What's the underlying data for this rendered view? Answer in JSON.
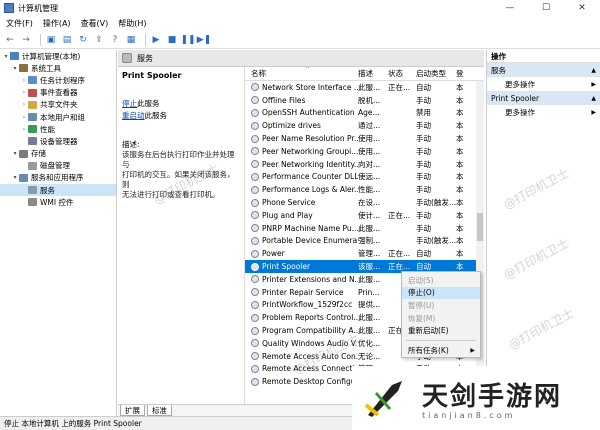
{
  "window": {
    "title": "计算机管理",
    "controls": [
      "—",
      "☐",
      "✕"
    ]
  },
  "menu": [
    "文件(F)",
    "操作(A)",
    "查看(V)",
    "帮助(H)"
  ],
  "tree": [
    {
      "label": "计算机管理(本地)",
      "level": 0,
      "arrow": "▾",
      "color": "#4a7fc1"
    },
    {
      "label": "系统工具",
      "level": 1,
      "arrow": "▾",
      "color": "#8a6d3b"
    },
    {
      "label": "任务计划程序",
      "level": 2,
      "arrow": "›",
      "color": "#5b8bd0"
    },
    {
      "label": "事件查看器",
      "level": 2,
      "arrow": "›",
      "color": "#c05050"
    },
    {
      "label": "共享文件夹",
      "level": 2,
      "arrow": "›",
      "color": "#d4a740"
    },
    {
      "label": "本地用户和组",
      "level": 2,
      "arrow": "›",
      "color": "#6a8ab0"
    },
    {
      "label": "性能",
      "level": 2,
      "arrow": "›",
      "color": "#3a9a5a"
    },
    {
      "label": "设备管理器",
      "level": 2,
      "arrow": "",
      "color": "#7a7a9a"
    },
    {
      "label": "存储",
      "level": 1,
      "arrow": "▾",
      "color": "#7a7a7a"
    },
    {
      "label": "磁盘管理",
      "level": 2,
      "arrow": "",
      "color": "#9a9a9a"
    },
    {
      "label": "服务和应用程序",
      "level": 1,
      "arrow": "▾",
      "color": "#6a8ab0"
    },
    {
      "label": "服务",
      "level": 2,
      "arrow": "",
      "color": "#8a9aaa",
      "selected": true
    },
    {
      "label": "WMI 控件",
      "level": 2,
      "arrow": "",
      "color": "#8a8a8a"
    }
  ],
  "header": {
    "title": "服务"
  },
  "detail": {
    "service_name": "Print Spooler",
    "stop_link": "停止",
    "stop_suffix": "此服务",
    "restart_link": "重启动",
    "restart_suffix": "此服务",
    "desc_label": "描述:",
    "desc_text": [
      "该服务在后台执行打印作业并处理与",
      "打印机的交互。如果关闭该服务，则",
      "无法进行打印或查看打印机。"
    ]
  },
  "columns": {
    "name": "名称",
    "desc": "描述",
    "state": "状态",
    "start": "启动类型",
    "login": "登"
  },
  "services": [
    {
      "name": "Network Store Interface ...",
      "desc": "此服...",
      "state": "正在...",
      "start": "自动",
      "login": "本"
    },
    {
      "name": "Offline Files",
      "desc": "脱机...",
      "state": "",
      "start": "手动",
      "login": "本"
    },
    {
      "name": "OpenSSH Authentication ...",
      "desc": "Age...",
      "state": "",
      "start": "禁用",
      "login": "本"
    },
    {
      "name": "Optimize drives",
      "desc": "通过...",
      "state": "",
      "start": "手动",
      "login": "本"
    },
    {
      "name": "Peer Name Resolution Pr...",
      "desc": "使用...",
      "state": "",
      "start": "手动",
      "login": "本"
    },
    {
      "name": "Peer Networking Groupi...",
      "desc": "使用...",
      "state": "",
      "start": "手动",
      "login": "本"
    },
    {
      "name": "Peer Networking Identity...",
      "desc": "向对...",
      "state": "",
      "start": "手动",
      "login": "本"
    },
    {
      "name": "Performance Counter DLL...",
      "desc": "使远...",
      "state": "",
      "start": "手动",
      "login": "本"
    },
    {
      "name": "Performance Logs & Aler...",
      "desc": "性能...",
      "state": "",
      "start": "手动",
      "login": "本"
    },
    {
      "name": "Phone Service",
      "desc": "在设...",
      "state": "",
      "start": "手动(触发...",
      "login": "本"
    },
    {
      "name": "Plug and Play",
      "desc": "使计...",
      "state": "正在...",
      "start": "手动",
      "login": "本"
    },
    {
      "name": "PNRP Machine Name Pu...",
      "desc": "此服...",
      "state": "",
      "start": "手动",
      "login": "本"
    },
    {
      "name": "Portable Device Enumera...",
      "desc": "强制...",
      "state": "",
      "start": "手动(触发...",
      "login": "本"
    },
    {
      "name": "Power",
      "desc": "管理...",
      "state": "正在...",
      "start": "自动",
      "login": "本"
    },
    {
      "name": "Print Spooler",
      "desc": "该服...",
      "state": "正在...",
      "start": "自动",
      "login": "本",
      "selected": true
    },
    {
      "name": "Printer Extensions and N...",
      "desc": "此服...",
      "state": "",
      "start": "手动",
      "login": "本"
    },
    {
      "name": "Printer Repair Service",
      "desc": "Prin...",
      "state": "",
      "start": "手动",
      "login": "本"
    },
    {
      "name": "PrintWorkflow_1529f2cc",
      "desc": "提供...",
      "state": "",
      "start": "手动",
      "login": "本"
    },
    {
      "name": "Problem Reports Control...",
      "desc": "此服...",
      "state": "",
      "start": "手动",
      "login": "本"
    },
    {
      "name": "Program Compatibility A...",
      "desc": "此服...",
      "state": "正在...",
      "start": "自动",
      "login": "本"
    },
    {
      "name": "Quality Windows Audio V...",
      "desc": "优化...",
      "state": "",
      "start": "手动",
      "login": "本"
    },
    {
      "name": "Remote Access Auto Con...",
      "desc": "无论...",
      "state": "",
      "start": "手动",
      "login": "本"
    },
    {
      "name": "Remote Access Connecti...",
      "desc": "管理...",
      "state": "",
      "start": "手动",
      "login": "本"
    },
    {
      "name": "Remote Desktop Configu...",
      "desc": "远程...",
      "state": "",
      "start": "手动",
      "login": "本"
    }
  ],
  "context_menu": [
    {
      "label": "启动(S)",
      "disabled": true
    },
    {
      "label": "停止(O)",
      "highlight": true
    },
    {
      "label": "暂停(U)",
      "disabled": true
    },
    {
      "label": "恢复(M)",
      "disabled": true
    },
    {
      "label": "重新启动(E)"
    },
    {
      "separator": true
    },
    {
      "label": "所有任务(K)",
      "submenu": true
    }
  ],
  "tabs": [
    "扩展",
    "标准"
  ],
  "actions": {
    "title": "操作",
    "sections": [
      {
        "label": "服务",
        "items": [
          "更多操作"
        ]
      },
      {
        "label": "Print Spooler",
        "items": [
          "更多操作"
        ]
      }
    ]
  },
  "statusbar": "停止 本地计算机 上的服务 Print Spooler",
  "watermark": "@打印机卫士",
  "logo": {
    "big": "天剑手游网",
    "small": "tianjian8.com"
  }
}
